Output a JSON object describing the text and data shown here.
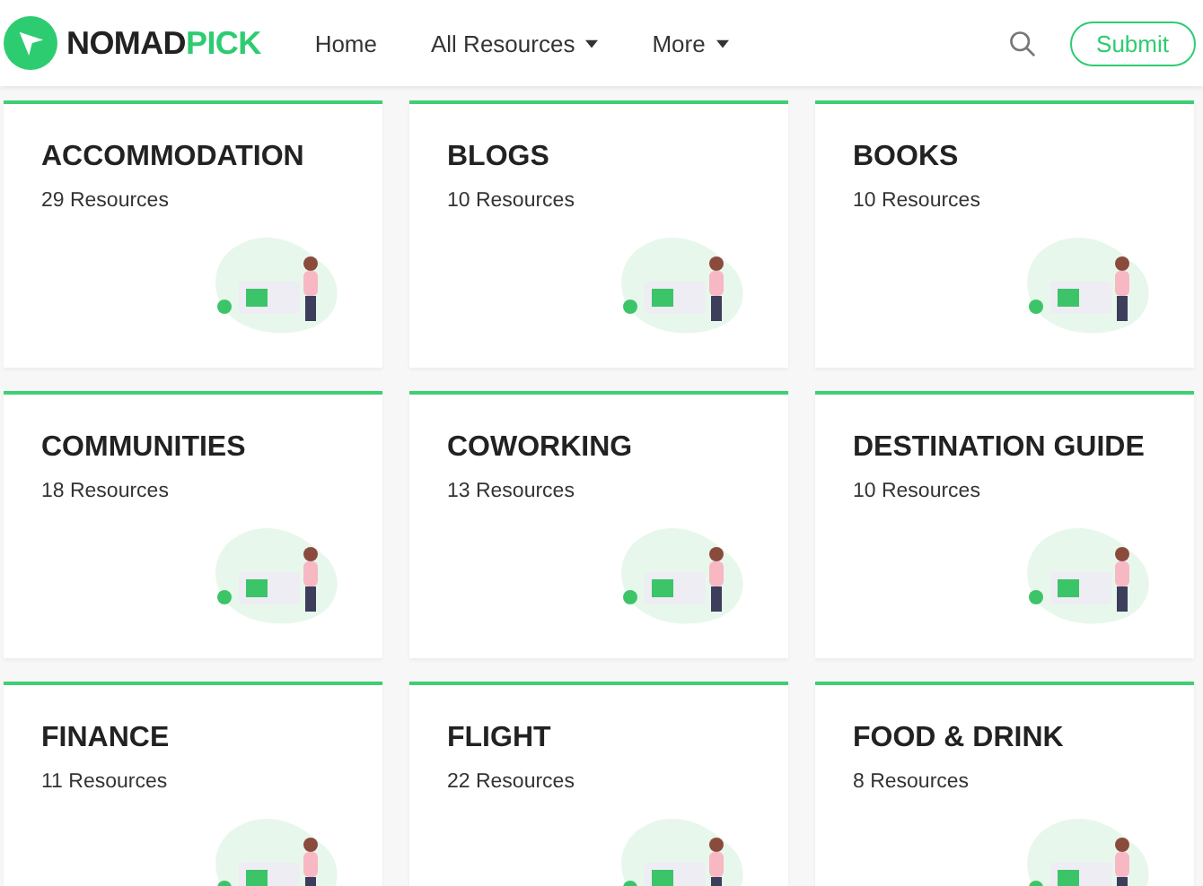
{
  "brand": {
    "name_dark": "NOMAD",
    "name_accent": "PICK"
  },
  "nav": [
    {
      "label": "Home",
      "dropdown": false
    },
    {
      "label": "All Resources",
      "dropdown": true
    },
    {
      "label": "More",
      "dropdown": true
    }
  ],
  "submit_button": "Submit",
  "categories": [
    {
      "title": "ACCOMMODATION",
      "count": "29 Resources"
    },
    {
      "title": "BLOGS",
      "count": "10 Resources"
    },
    {
      "title": "BOOKS",
      "count": "10 Resources"
    },
    {
      "title": "COMMUNITIES",
      "count": "18 Resources"
    },
    {
      "title": "COWORKING",
      "count": "13 Resources"
    },
    {
      "title": "DESTINATION GUIDE",
      "count": "10 Resources"
    },
    {
      "title": "FINANCE",
      "count": "11 Resources"
    },
    {
      "title": "FLIGHT",
      "count": "22 Resources"
    },
    {
      "title": "FOOD & DRINK",
      "count": "8 Resources"
    }
  ]
}
